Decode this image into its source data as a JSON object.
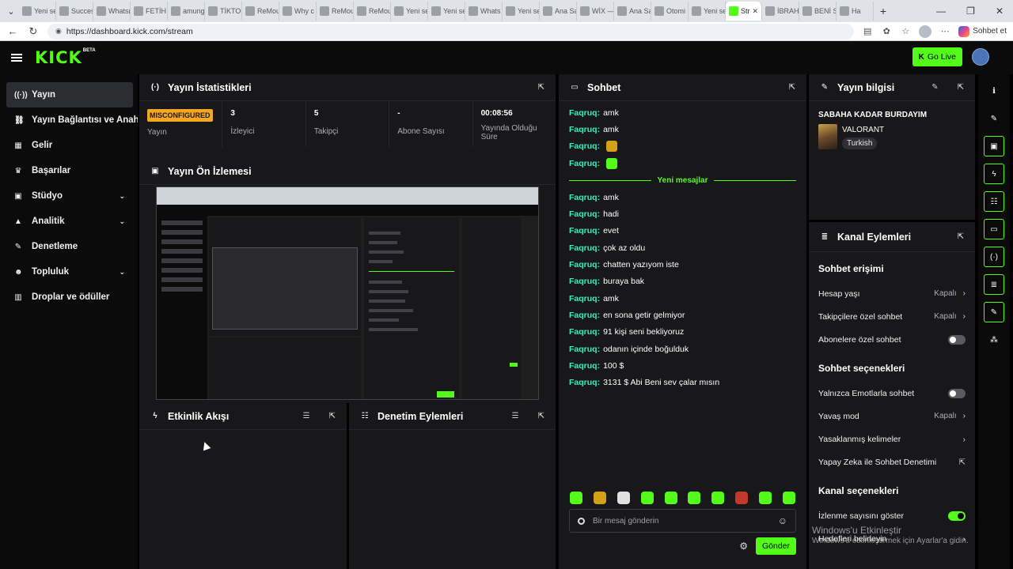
{
  "browser": {
    "tabs": [
      {
        "label": "Yeni se",
        "active": false
      },
      {
        "label": "Succes:",
        "active": false
      },
      {
        "label": "Whats(",
        "active": false
      },
      {
        "label": "FETİH",
        "active": false
      },
      {
        "label": "amung",
        "active": false
      },
      {
        "label": "TİKTOI",
        "active": false
      },
      {
        "label": "ReMou",
        "active": false
      },
      {
        "label": "Why c",
        "active": false
      },
      {
        "label": "ReMou",
        "active": false
      },
      {
        "label": "ReMou",
        "active": false
      },
      {
        "label": "Yeni se",
        "active": false
      },
      {
        "label": "Yeni se",
        "active": false
      },
      {
        "label": "Whats",
        "active": false
      },
      {
        "label": "Yeni se",
        "active": false
      },
      {
        "label": "Ana Sa",
        "active": false
      },
      {
        "label": "WİX —",
        "active": false
      },
      {
        "label": "Ana Sa",
        "active": false
      },
      {
        "label": "Otomi",
        "active": false
      },
      {
        "label": "Yeni se",
        "active": false
      },
      {
        "label": "Str",
        "active": true
      },
      {
        "label": "İBRAH",
        "active": false
      },
      {
        "label": "BENİ S",
        "active": false
      },
      {
        "label": "Ha",
        "active": false
      }
    ],
    "url": "https://dashboard.kick.com/stream",
    "copilot_label": "Sohbet et"
  },
  "app": {
    "logo": "KICK",
    "beta": "BETA",
    "go_live": "Go Live"
  },
  "sidebar": {
    "items": [
      {
        "label": "Yayın",
        "icon": "broadcast-icon",
        "glyph": "((·))",
        "active": true,
        "chevron": false
      },
      {
        "label": "Yayın Bağlantısı ve Anahtarı",
        "icon": "link-icon",
        "glyph": "⛓",
        "active": false,
        "chevron": false
      },
      {
        "label": "Gelir",
        "icon": "revenue-icon",
        "glyph": "▦",
        "active": false,
        "chevron": false
      },
      {
        "label": "Başarılar",
        "icon": "trophy-icon",
        "glyph": "♛",
        "active": false,
        "chevron": false
      },
      {
        "label": "Stüdyo",
        "icon": "studio-icon",
        "glyph": "▣",
        "active": false,
        "chevron": true
      },
      {
        "label": "Analitik",
        "icon": "analytics-icon",
        "glyph": "▲",
        "active": false,
        "chevron": true
      },
      {
        "label": "Denetleme",
        "icon": "wrench-icon",
        "glyph": "✎",
        "active": false,
        "chevron": false
      },
      {
        "label": "Topluluk",
        "icon": "community-icon",
        "glyph": "☻",
        "active": false,
        "chevron": true
      },
      {
        "label": "Droplar ve ödüller",
        "icon": "drops-icon",
        "glyph": "▥",
        "active": false,
        "chevron": false
      }
    ]
  },
  "stats_panel": {
    "title": "Yayın İstatistikleri",
    "status_badge": "MISCONFIGURED",
    "status_label": "Yayın",
    "stats": [
      {
        "value": "3",
        "label": "İzleyici"
      },
      {
        "value": "5",
        "label": "Takipçi"
      },
      {
        "value": "-",
        "label": "Abone Sayısı"
      },
      {
        "value": "00:08:56",
        "label": "Yayında Olduğu Süre"
      }
    ]
  },
  "preview_panel": {
    "title": "Yayın Ön İzlemesi"
  },
  "activity_panel": {
    "title": "Etkinlik Akışı"
  },
  "mod_panel": {
    "title": "Denetim Eylemleri"
  },
  "chat": {
    "title": "Sohbet",
    "messages_before": [
      {
        "user": "Faqruq:",
        "text": "amk",
        "emote": ""
      },
      {
        "user": "Faqruq:",
        "text": "amk",
        "emote": ""
      },
      {
        "user": "Faqruq:",
        "text": "",
        "emote": "#d4a017"
      },
      {
        "user": "Faqruq:",
        "text": "",
        "emote": "#53fc18"
      }
    ],
    "new_messages_label": "Yeni mesajlar",
    "messages_after": [
      {
        "user": "Faqruq:",
        "text": "amk"
      },
      {
        "user": "Faqruq:",
        "text": "hadi"
      },
      {
        "user": "Faqruq:",
        "text": "evet"
      },
      {
        "user": "Faqruq:",
        "text": "çok az oldu"
      },
      {
        "user": "Faqruq:",
        "text": "chatten yazıyom iste"
      },
      {
        "user": "Faqruq:",
        "text": "buraya bak"
      },
      {
        "user": "Faqruq:",
        "text": "amk"
      },
      {
        "user": "Faqruq:",
        "text": "en sona getir gelmiyor"
      },
      {
        "user": "Faqruq:",
        "text": "91 kişi seni bekliyoruz"
      },
      {
        "user": "Faqruq:",
        "text": "odanın içinde boğulduk"
      },
      {
        "user": "Faqruq:",
        "text": "100 $"
      },
      {
        "user": "Faqruq:",
        "text": "3131 $ Abi Beni sev çalar mısın"
      }
    ],
    "emotes": [
      "#53fc18",
      "#d4a017",
      "#e0e0e0",
      "#53fc18",
      "#53fc18",
      "#53fc18",
      "#53fc18",
      "#c0392b",
      "#53fc18",
      "#53fc18"
    ],
    "input_placeholder": "Bir mesaj gönderin",
    "send_label": "Gönder"
  },
  "stream_info": {
    "title": "Yayın bilgisi",
    "stream_title": "SABAHA KADAR BURDAYIM",
    "game": "VALORANT",
    "tag": "Turkish"
  },
  "channel_actions": {
    "title": "Kanal Eylemleri",
    "sections": [
      {
        "heading": "Sohbet erişimi",
        "rows": [
          {
            "label": "Hesap yaşı",
            "value": "Kapalı",
            "kind": "chevron"
          },
          {
            "label": "Takipçilere özel sohbet",
            "value": "Kapalı",
            "kind": "chevron"
          },
          {
            "label": "Abonelere özel sohbet",
            "value": "",
            "kind": "toggle-off"
          }
        ]
      },
      {
        "heading": "Sohbet seçenekleri",
        "rows": [
          {
            "label": "Yalnızca Emotlarla sohbet",
            "value": "",
            "kind": "toggle-off"
          },
          {
            "label": "Yavaş mod",
            "value": "Kapalı",
            "kind": "chevron"
          },
          {
            "label": "Yasaklanmış kelimeler",
            "value": "",
            "kind": "chevron"
          },
          {
            "label": "Yapay Zeka ile Sohbet Denetimi",
            "value": "",
            "kind": "external"
          }
        ]
      },
      {
        "heading": "Kanal seçenekleri",
        "rows": [
          {
            "label": "İzlenme sayısını göster",
            "value": "",
            "kind": "toggle-on"
          },
          {
            "label": "Hedefleri belirleyin",
            "value": "",
            "kind": "chevron"
          }
        ]
      }
    ]
  },
  "right_rail": [
    "info-icon",
    "pencil-icon",
    "preview-icon",
    "lightning-icon",
    "list-icon",
    "chat-icon",
    "broadcast-icon",
    "layers-icon",
    "wrench-icon",
    "share-icon"
  ],
  "watermark": {
    "line1": "Windows'u Etkinleştir",
    "line2": "Windows'u etkinleştirmek için Ayarlar'a gidin."
  }
}
